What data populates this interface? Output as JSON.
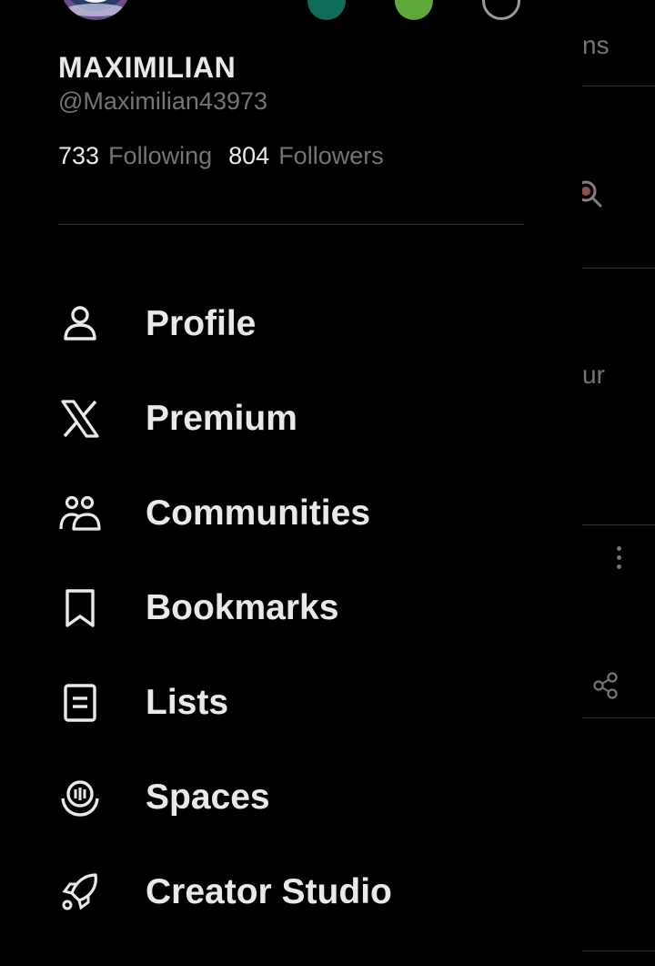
{
  "profile": {
    "display_name": "MAXIMILIAN",
    "handle": "@Maximilian43973",
    "following_count": "733",
    "following_label": "Following",
    "followers_count": "804",
    "followers_label": "Followers"
  },
  "menu": {
    "items": [
      {
        "label": "Profile",
        "icon": "person-icon"
      },
      {
        "label": "Premium",
        "icon": "x-logo-icon"
      },
      {
        "label": "Communities",
        "icon": "communities-icon"
      },
      {
        "label": "Bookmarks",
        "icon": "bookmark-icon"
      },
      {
        "label": "Lists",
        "icon": "list-icon"
      },
      {
        "label": "Spaces",
        "icon": "spaces-icon"
      },
      {
        "label": "Creator Studio",
        "icon": "rocket-icon"
      }
    ]
  },
  "background": {
    "fragment_1": "ns",
    "fragment_2": "ur"
  },
  "colors": {
    "background": "#000000",
    "text_primary": "#e7e9ea",
    "text_secondary": "#71767b",
    "divider": "#2f3336"
  }
}
